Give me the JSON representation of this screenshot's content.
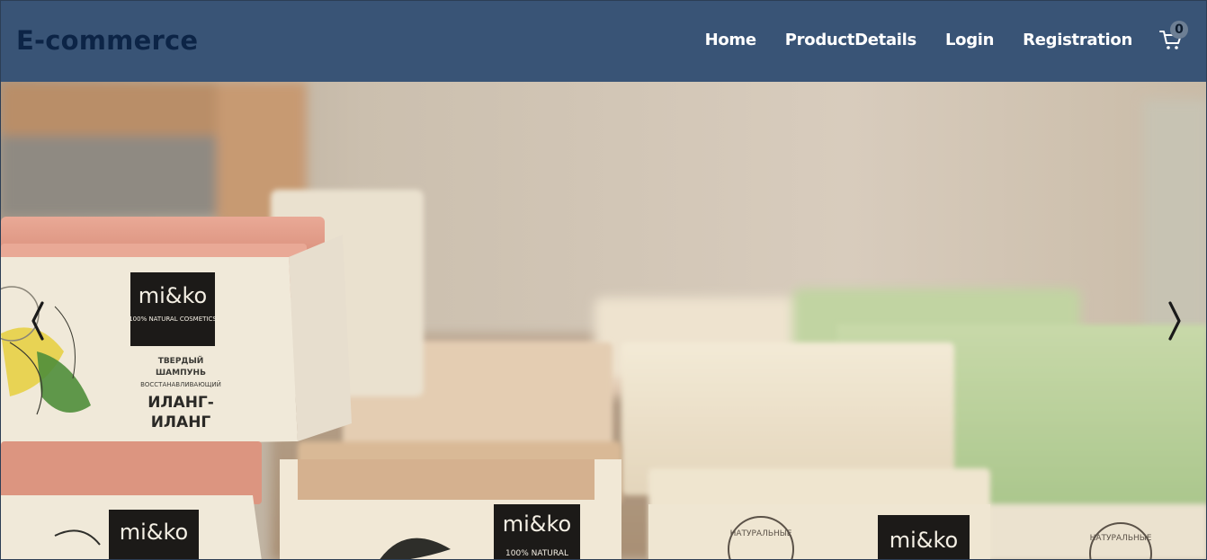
{
  "header": {
    "brand": "E-commerce",
    "nav_links": [
      "Home",
      "ProductDetails",
      "Login",
      "Registration"
    ],
    "cart_count": "0"
  },
  "carousel": {
    "product_labels": {
      "brand_mark": "mi&ko",
      "tagline": "100% NATURAL",
      "tagline_full": "100% NATURAL COSMETICS",
      "product_line1": "ТВЕРДЫЙ",
      "product_line2": "ШАМПУНЬ",
      "product_line3": "ВОССТАНАВЛИВАЮЩИЙ",
      "product_name1": "ИЛАНГ-",
      "product_name2": "ИЛАНГ",
      "stamp_text": "НАТУРАЛЬНЫЕ"
    }
  },
  "icons": {
    "cart": "shopping-cart-icon",
    "prev": "chevron-left-icon",
    "next": "chevron-right-icon"
  },
  "colors": {
    "navbar": "#395476",
    "brand": "#0c2446",
    "nav_text": "#ffffff",
    "badge": "#6d7f94"
  }
}
